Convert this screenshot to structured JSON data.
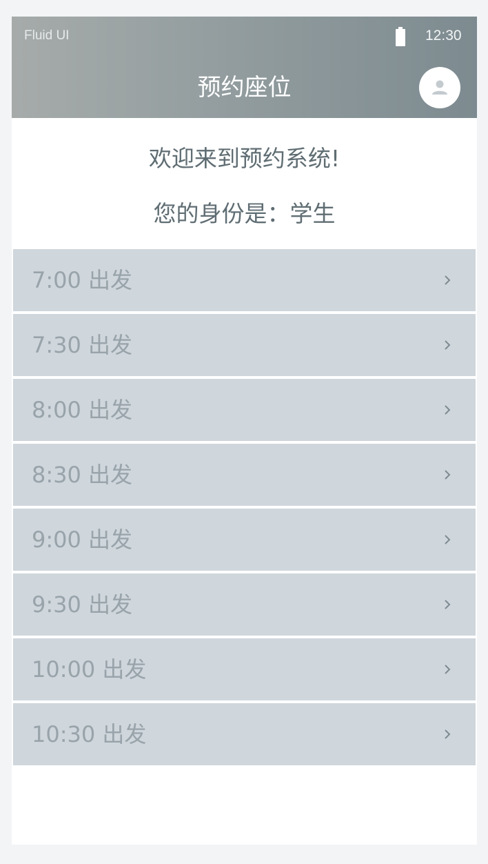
{
  "status_bar": {
    "carrier": "Fluid UI",
    "battery_icon": "battery-icon",
    "time": "12:30"
  },
  "app_bar": {
    "title": "预约座位",
    "avatar_icon": "person-icon",
    "gradient_colors": [
      "#a6abaa",
      "#7d8b90"
    ]
  },
  "welcome": {
    "message": "欢迎来到预约系统!",
    "identity": "您的身份是：学生"
  },
  "departures": [
    {
      "label": "7:00 出发"
    },
    {
      "label": "7:30 出发"
    },
    {
      "label": "8:00 出发"
    },
    {
      "label": "8:30 出发"
    },
    {
      "label": "9:00 出发"
    },
    {
      "label": "9:30 出发"
    },
    {
      "label": "10:00 出发"
    },
    {
      "label": "10:30 出发"
    }
  ],
  "colors": {
    "list_item_bg": "#cfd6dc",
    "list_item_text": "#98a3aa",
    "body_text": "#5f6d73"
  }
}
